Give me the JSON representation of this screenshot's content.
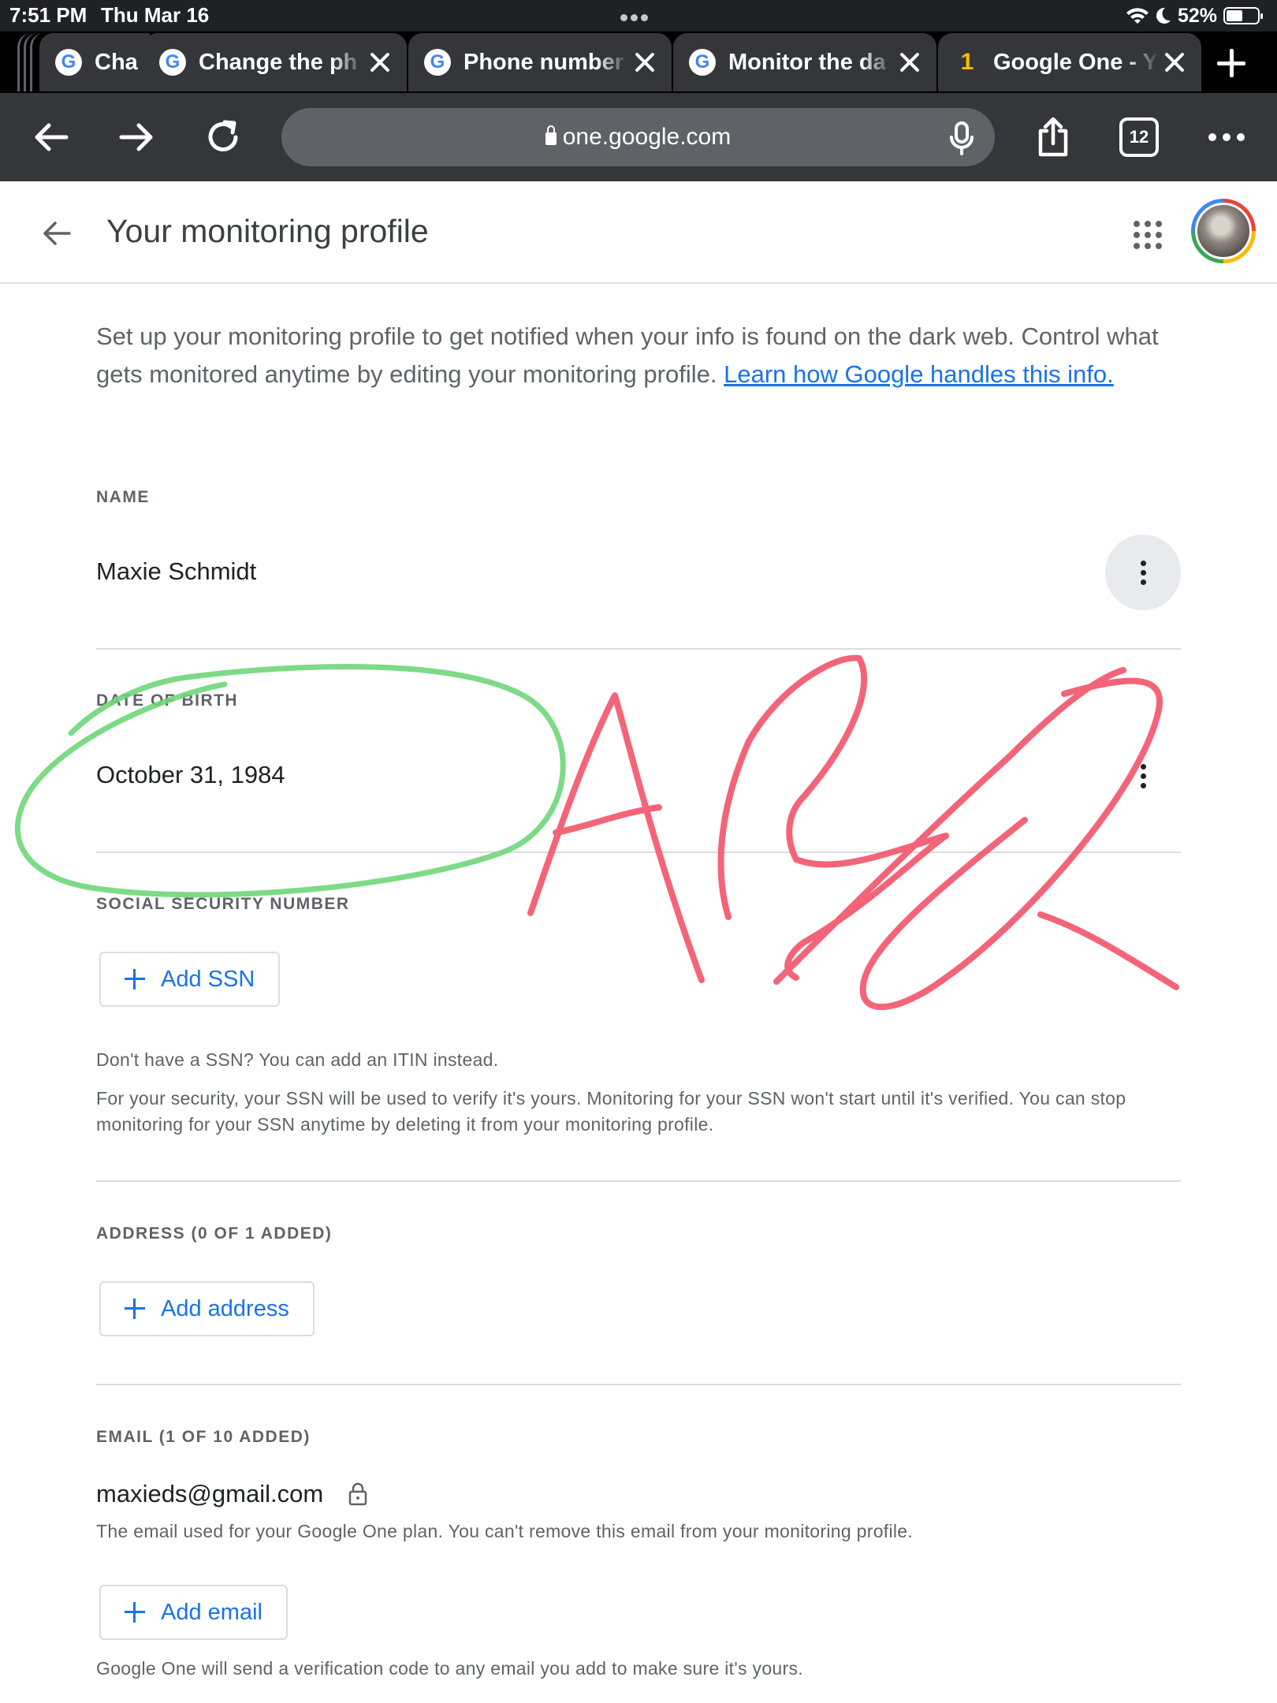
{
  "status_bar": {
    "time": "7:51 PM",
    "date": "Thu Mar 16",
    "battery": "52%",
    "battery_level": 0.52
  },
  "tabs": [
    {
      "title": "Cha",
      "favicon": "google-g-icon",
      "active": false
    },
    {
      "title": "Change the ph",
      "favicon": "google-g-icon",
      "active": false
    },
    {
      "title": "Phone number",
      "favicon": "google-g-icon",
      "active": false
    },
    {
      "title": "Monitor the da",
      "favicon": "google-g-icon",
      "active": false
    },
    {
      "title": "Google One - Y",
      "favicon": "google-one-icon",
      "active": true
    }
  ],
  "toolbar": {
    "url": "one.google.com",
    "tab_count": "12"
  },
  "header": {
    "title": "Your monitoring profile"
  },
  "intro": {
    "text": "Set up your monitoring profile to get notified when your info is found on the dark web. Control what gets monitored anytime by editing your monitoring profile.",
    "link": "Learn how Google handles this info."
  },
  "name_section": {
    "label": "NAME",
    "value": "Maxie Schmidt"
  },
  "dob_section": {
    "label": "DATE OF BIRTH",
    "value": "October 31, 1984"
  },
  "ssn_section": {
    "label": "SOCIAL SECURITY NUMBER",
    "button": "Add SSN",
    "itin_note": "Don't have a SSN? You can add an ITIN instead.",
    "security_note": "For your security, your SSN will be used to verify it's yours. Monitoring for your SSN won't start until it's verified. You can stop monitoring for your SSN anytime by deleting it from your monitoring profile."
  },
  "address_section": {
    "label": "ADDRESS (0 OF 1 ADDED)",
    "button": "Add address"
  },
  "email_section": {
    "label": "EMAIL (1 OF 10 ADDED)",
    "value": "maxieds@gmail.com",
    "note": "The email used for your Google One plan. You can't remove this email from your monitoring profile.",
    "button": "Add email",
    "verify_note": "Google One will send a verification code to any email you add to make sure it's yours."
  },
  "colors": {
    "accent": "#1a73e8",
    "green_ink": "#6fd67a",
    "red_ink": "#f2546a"
  }
}
